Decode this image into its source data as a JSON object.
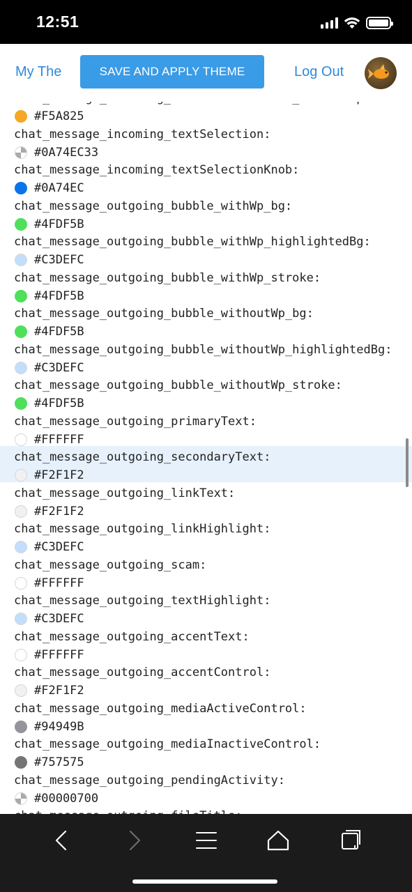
{
  "status_bar": {
    "time": "12:51"
  },
  "header": {
    "title": "My The",
    "save_label": "SAVE AND APPLY THEME",
    "logout_label": "Log Out"
  },
  "items": [
    {
      "key": "chat_message_incoming_actionButtonsText_withoutWp:",
      "value": "#F5A825",
      "color": "#F5A825"
    },
    {
      "key": "chat_message_incoming_textSelection:",
      "value": "#0A74EC33",
      "color": "#0A74EC33",
      "checker": true
    },
    {
      "key": "chat_message_incoming_textSelectionKnob:",
      "value": "#0A74EC",
      "color": "#0A74EC"
    },
    {
      "key": "chat_message_outgoing_bubble_withWp_bg:",
      "value": "#4FDF5B",
      "color": "#4FDF5B"
    },
    {
      "key": "chat_message_outgoing_bubble_withWp_highlightedBg:",
      "value": "#C3DEFC",
      "color": "#C3DEFC"
    },
    {
      "key": "chat_message_outgoing_bubble_withWp_stroke:",
      "value": "#4FDF5B",
      "color": "#4FDF5B"
    },
    {
      "key": "chat_message_outgoing_bubble_withoutWp_bg:",
      "value": "#4FDF5B",
      "color": "#4FDF5B"
    },
    {
      "key": "chat_message_outgoing_bubble_withoutWp_highlightedBg:",
      "value": "#C3DEFC",
      "color": "#C3DEFC"
    },
    {
      "key": "chat_message_outgoing_bubble_withoutWp_stroke:",
      "value": "#4FDF5B",
      "color": "#4FDF5B"
    },
    {
      "key": "chat_message_outgoing_primaryText:",
      "value": "#FFFFFF",
      "color": "#FFFFFF"
    },
    {
      "key": "chat_message_outgoing_secondaryText:",
      "value": "#F2F1F2",
      "color": "#F2F1F2",
      "highlight": true
    },
    {
      "key": "chat_message_outgoing_linkText:",
      "value": "#F2F1F2",
      "color": "#F2F1F2"
    },
    {
      "key": "chat_message_outgoing_linkHighlight:",
      "value": "#C3DEFC",
      "color": "#C3DEFC"
    },
    {
      "key": "chat_message_outgoing_scam:",
      "value": "#FFFFFF",
      "color": "#FFFFFF"
    },
    {
      "key": "chat_message_outgoing_textHighlight:",
      "value": "#C3DEFC",
      "color": "#C3DEFC"
    },
    {
      "key": "chat_message_outgoing_accentText:",
      "value": "#FFFFFF",
      "color": "#FFFFFF"
    },
    {
      "key": "chat_message_outgoing_accentControl:",
      "value": "#F2F1F2",
      "color": "#F2F1F2"
    },
    {
      "key": "chat_message_outgoing_mediaActiveControl:",
      "value": "#94949B",
      "color": "#94949B"
    },
    {
      "key": "chat_message_outgoing_mediaInactiveControl:",
      "value": "#757575",
      "color": "#757575"
    },
    {
      "key": "chat_message_outgoing_pendingActivity:",
      "value": "#00000700",
      "color": "#00000700",
      "checker": true
    },
    {
      "key": "chat_message_outgoing_fileTitle:",
      "value": "",
      "color": "#FFFFFF"
    }
  ],
  "toolbar": {
    "back_icon": "chevron-left-icon",
    "forward_icon": "chevron-right-icon",
    "menu_icon": "hamburger-menu-icon",
    "home_icon": "home-icon",
    "tabs_icon": "tabs-icon"
  }
}
